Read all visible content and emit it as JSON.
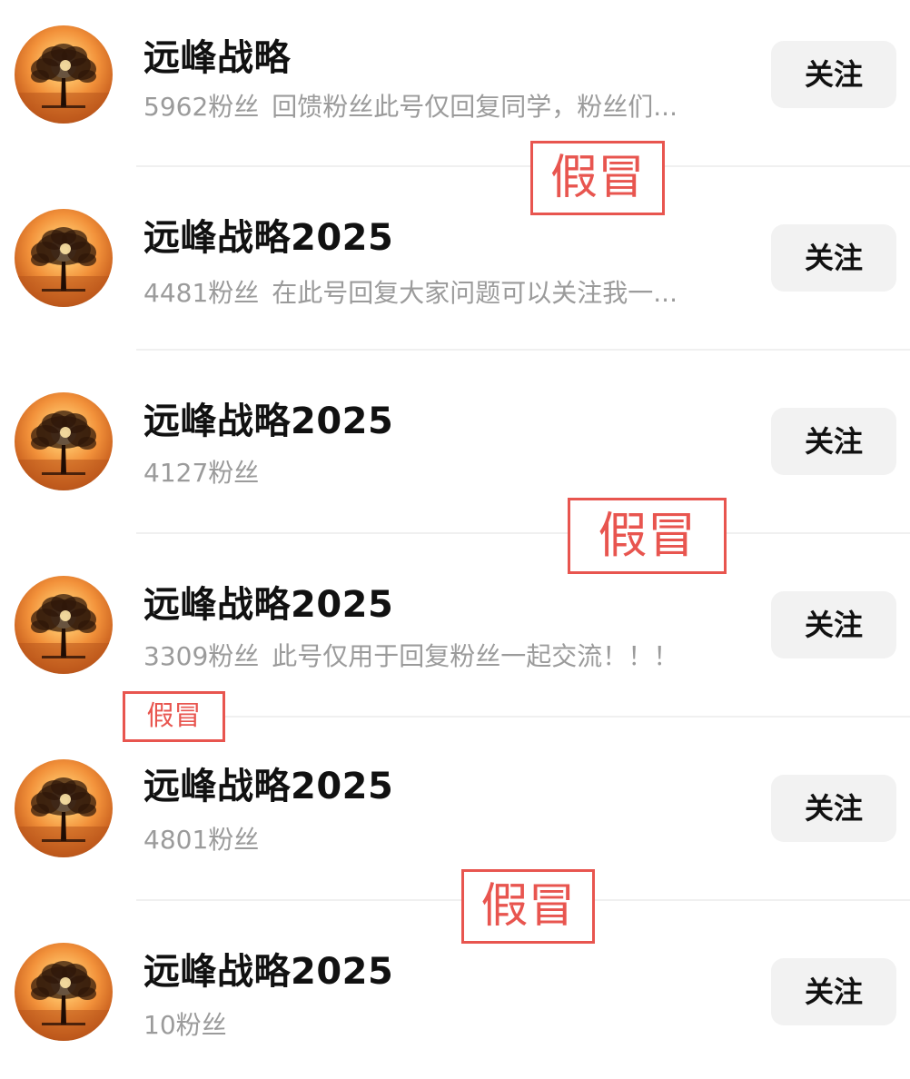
{
  "accounts": [
    {
      "name": "远峰战略",
      "fans": "5962粉丝",
      "desc": "回馈粉丝此号仅回复同学，粉丝们...",
      "follow_label": "关注"
    },
    {
      "name": "远峰战略2025",
      "fans": "4481粉丝",
      "desc": "在此号回复大家问题可以关注我一...",
      "follow_label": "关注"
    },
    {
      "name": "远峰战略2025",
      "fans": "4127粉丝",
      "desc": "",
      "follow_label": "关注"
    },
    {
      "name": "远峰战略2025",
      "fans": "3309粉丝",
      "desc": "此号仅用于回复粉丝一起交流！！！",
      "follow_label": "关注"
    },
    {
      "name": "远峰战略2025",
      "fans": "4801粉丝",
      "desc": "",
      "follow_label": "关注"
    },
    {
      "name": "远峰战略2025",
      "fans": "10粉丝",
      "desc": "",
      "follow_label": "关注"
    }
  ],
  "annotations": [
    {
      "text": "假冒"
    },
    {
      "text": "假冒"
    },
    {
      "text": "假冒"
    },
    {
      "text": "假冒"
    }
  ],
  "colors": {
    "annotation": "#e8554f",
    "name_text": "#111111",
    "meta_text": "#9b9b9b",
    "button_bg": "#f2f2f2"
  },
  "icons": {
    "avatar": "sunset-tree-icon"
  }
}
